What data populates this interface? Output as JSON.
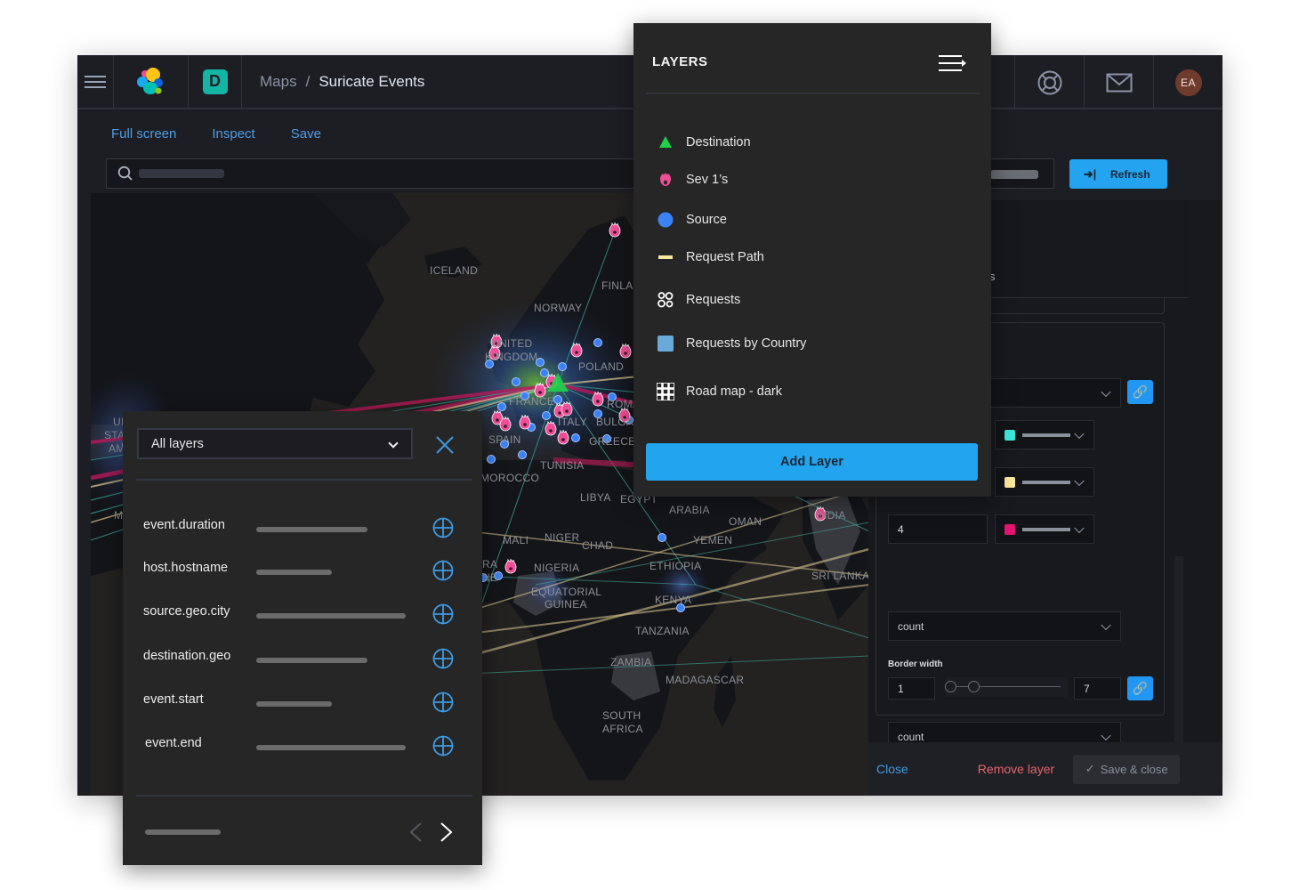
{
  "header": {
    "space_letter": "D",
    "breadcrumb": {
      "root": "Maps",
      "separator": "/",
      "current": "Suricate Events"
    },
    "avatar_initials": "EA",
    "icons": [
      "menu-icon",
      "elastic-logo-icon",
      "help-lifebuoy-icon",
      "mail-icon"
    ]
  },
  "actions": {
    "full_screen": "Full screen",
    "inspect": "Inspect",
    "save": "Save"
  },
  "query_bar": {
    "refresh_label": "Refresh"
  },
  "layers_panel": {
    "title": "LAYERS",
    "items": [
      {
        "label": "Destination",
        "icon": "triangle-icon",
        "color": "#1fd14a"
      },
      {
        "label": "Sev 1’s",
        "icon": "flame-icon",
        "color": "#f04e98"
      },
      {
        "label": "Source",
        "icon": "circle-icon",
        "color": "#3b82f6"
      },
      {
        "label": "Request Path",
        "icon": "line-icon",
        "color": "#f9e79f"
      },
      {
        "label": "Requests",
        "icon": "cluster-icon",
        "color": "#ffffff"
      },
      {
        "label": "Requests by Country",
        "icon": "square-icon",
        "color": "#6aaad8"
      },
      {
        "label": "Road map - dark",
        "icon": "grid-icon",
        "color": "#ffffff"
      }
    ],
    "add_layer_label": "Add Layer"
  },
  "tooltip_panel": {
    "layer_select": "All layers",
    "fields": [
      {
        "name": "event.duration"
      },
      {
        "name": "host.hostname"
      },
      {
        "name": "source.geo.city"
      },
      {
        "name": "destination.geo"
      },
      {
        "name": "event.start"
      },
      {
        "name": "event.end"
      }
    ]
  },
  "layer_editor": {
    "partial_header_text": "s",
    "color_stops": [
      {
        "color": "#3ee8da"
      },
      {
        "color": "#fbe79d"
      },
      {
        "value": "4",
        "color": "#e0146f"
      }
    ],
    "color_field_select": "count",
    "border_width": {
      "label": "Border width",
      "min": "1",
      "max": "7"
    },
    "border_field_select": "count",
    "footer": {
      "close": "Close",
      "remove": "Remove layer",
      "save_close": "Save & close"
    }
  },
  "map": {
    "labels": [
      "ICELAND",
      "FINLA",
      "NORWAY",
      "UNITED",
      "KINGDOM",
      "POLAND",
      "FRANCE",
      "ROMAN",
      "ITALY",
      "BULGA",
      "SPAIN",
      "GREECE",
      "TUNISIA",
      "MOROCCO",
      "LIBYA",
      "EGYPT",
      "ARABIA",
      "OMAN",
      "INDIA",
      "MALI",
      "NIGER",
      "CHAD",
      "YEMEN",
      "NIGERIA",
      "ETHIOPIA",
      "SRI LANKA",
      "EQUATORIAL",
      "GUINEA",
      "KENYA",
      "TANZANIA",
      "ZAMBIA",
      "MADAGASCAR",
      "SOUTH",
      "AFRICA",
      "UI",
      "STA",
      "AM",
      "M",
      "RA",
      "NE"
    ]
  }
}
